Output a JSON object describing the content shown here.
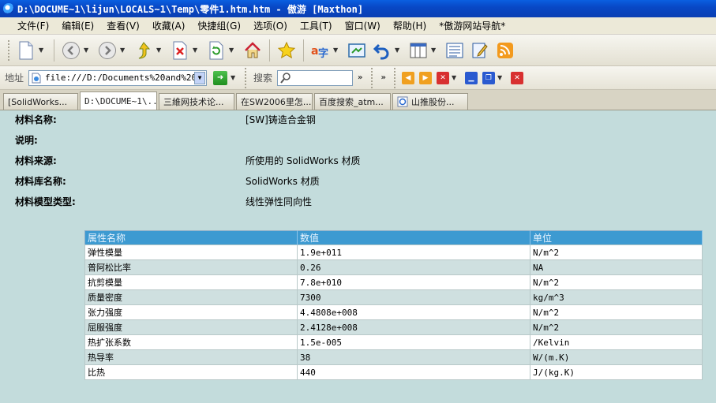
{
  "window": {
    "title": "D:\\DOCUME~1\\lijun\\LOCALS~1\\Temp\\零件1.htm.htm - 傲游 [Maxthon]"
  },
  "menu": {
    "items": [
      "文件(F)",
      "编辑(E)",
      "查看(V)",
      "收藏(A)",
      "快捷组(G)",
      "选项(O)",
      "工具(T)",
      "窗口(W)",
      "帮助(H)",
      "*傲游网站导航*"
    ]
  },
  "address": {
    "label": "地址",
    "value": "file:///D:/Documents%20and%20Se"
  },
  "search": {
    "label": "搜索"
  },
  "tabs": [
    {
      "label": "[SolidWorks...",
      "active": false
    },
    {
      "label": "D:\\DOCUME~1\\...",
      "active": true
    },
    {
      "label": "三維网技术论...",
      "active": false
    },
    {
      "label": "在SW2006里怎...",
      "active": false
    },
    {
      "label": "百度搜索_atm...",
      "active": false
    },
    {
      "label": "山推股份...",
      "active": false
    }
  ],
  "material": {
    "name_label": "材料名称:",
    "name_value": "[SW]铸造合金钢",
    "desc_label": "说明:",
    "source_label": "材料来源:",
    "source_value": "所使用的 SolidWorks 材质",
    "library_label": "材料库名称:",
    "library_value": "SolidWorks 材质",
    "model_label": "材料模型类型:",
    "model_value": "线性弹性同向性"
  },
  "table": {
    "headers": [
      "属性名称",
      "数值",
      "单位"
    ],
    "rows": [
      [
        "弹性模量",
        "1.9e+011",
        "N/m^2"
      ],
      [
        "普阿松比率",
        "0.26",
        "NA"
      ],
      [
        "抗剪模量",
        "7.8e+010",
        "N/m^2"
      ],
      [
        "质量密度",
        "7300",
        "kg/m^3"
      ],
      [
        "张力强度",
        "4.4808e+008",
        "N/m^2"
      ],
      [
        "屈服强度",
        "2.4128e+008",
        "N/m^2"
      ],
      [
        "热扩张系数",
        "1.5e-005",
        "/Kelvin"
      ],
      [
        "热导率",
        "38",
        "W/(m.K)"
      ],
      [
        "比热",
        "440",
        "J/(kg.K)"
      ]
    ]
  }
}
